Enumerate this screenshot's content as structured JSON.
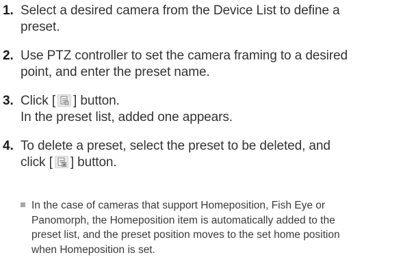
{
  "steps": [
    {
      "number": "1.",
      "lines": [
        "Select a desired camera from the Device List to define a",
        "preset."
      ]
    },
    {
      "number": "2.",
      "lines": [
        "Use PTZ controller to set the camera framing to a desired",
        "point, and enter the preset name."
      ]
    },
    {
      "number": "3.",
      "line1_before": "Click [",
      "line1_after": "] button.",
      "icon": "add-preset-icon",
      "line2": "In the preset list, added one appears."
    },
    {
      "number": "4.",
      "line1": "To delete a preset, select the preset to be deleted, and",
      "line2_before": "click [",
      "line2_after": "] button.",
      "icon": "delete-preset-icon"
    }
  ],
  "note": {
    "icon": "square-bullet-icon",
    "lines": [
      "In the case of cameras that support Homeposition, Fish Eye or",
      "Panomorph, the Homeposition item is automatically added to the",
      "preset list, and the preset position moves to the set home position",
      "when Homeposition is set."
    ]
  }
}
